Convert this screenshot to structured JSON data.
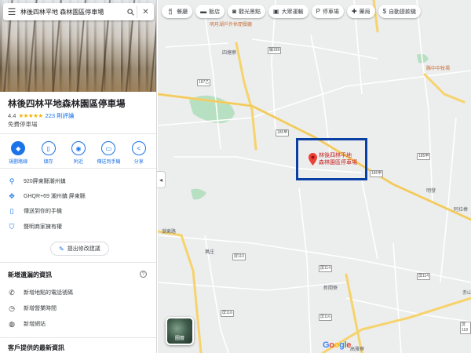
{
  "search": {
    "query": "林後四林平地 森林園區停車場"
  },
  "place": {
    "title": "林後四林平地森林園區停車場",
    "rating": "4.4",
    "stars": "★★★★★",
    "reviews": "223 則評論",
    "category": "免費停車場"
  },
  "actions": [
    {
      "label": "規劃路線",
      "icon": "directions-icon"
    },
    {
      "label": "儲存",
      "icon": "bookmark-icon"
    },
    {
      "label": "附近",
      "icon": "nearby-icon"
    },
    {
      "label": "傳送到手機",
      "icon": "send-to-phone-icon"
    },
    {
      "label": "分享",
      "icon": "share-icon"
    }
  ],
  "info": [
    {
      "text": "920屏東縣潮州鎮",
      "icon": "location-pin-icon"
    },
    {
      "text": "GHQR+69 潮州鎮 屏東縣",
      "icon": "plus-code-icon"
    },
    {
      "text": "傳送到你的手機",
      "icon": "phone-icon"
    },
    {
      "text": "聲明商家擁有權",
      "icon": "shield-check-icon"
    }
  ],
  "suggest_edit": "提出修改建議",
  "missing_info": {
    "title": "新增遺漏的資訊",
    "items": [
      {
        "text": "新增地點的電話號碼",
        "icon": "phone-call-icon"
      },
      {
        "text": "新增營業時間",
        "icon": "clock-icon"
      },
      {
        "text": "新增網站",
        "icon": "globe-icon"
      }
    ]
  },
  "latest_info_title": "客戶提供的最新資訊",
  "chips": [
    {
      "label": "餐廳",
      "icon": "restaurant-icon"
    },
    {
      "label": "飯店",
      "icon": "hotel-icon"
    },
    {
      "label": "觀光景點",
      "icon": "camera-icon"
    },
    {
      "label": "大眾運輸",
      "icon": "transit-icon"
    },
    {
      "label": "停車場",
      "icon": "parking-icon"
    },
    {
      "label": "藥局",
      "icon": "pharmacy-icon"
    },
    {
      "label": "自動提款機",
      "icon": "atm-icon"
    }
  ],
  "map_labels": {
    "top_place": "明月湖戶外休閒餐廳",
    "sitang": "四塘寮",
    "kitchen": "縣中中牧場",
    "mingfa": "明發",
    "alibao": "阿拉棒",
    "road_chao": "潮東路",
    "wuzhuang": "萬庄",
    "xinkai": "新開寮",
    "chishan": "赤山",
    "gaoya": "高雅寮"
  },
  "shields": [
    "縣189",
    "187乙",
    "185甲",
    "185甲",
    "185甲",
    "屏110",
    "屏114",
    "屏114",
    "屏116",
    "屏116",
    "屏118"
  ],
  "pin_label": [
    "林後四林平地",
    "森林園區停車場"
  ],
  "layer_label": "圖層",
  "logo": "Google"
}
